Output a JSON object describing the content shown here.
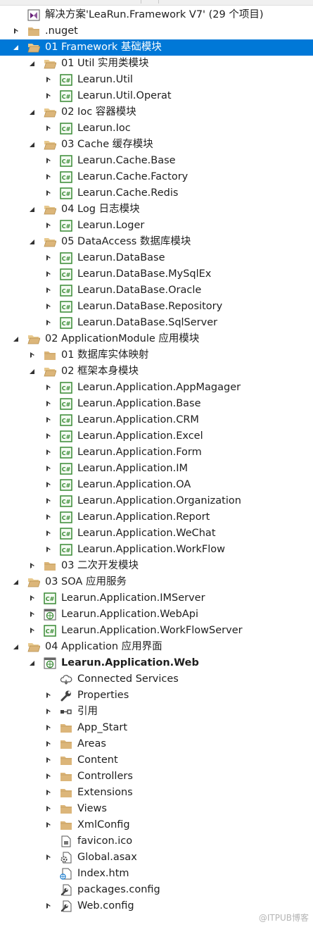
{
  "panel": "solution-explorer",
  "watermark": "@ITPUB博客",
  "colors": {
    "selection": "#0078d7",
    "folder": "#dcb67a",
    "project": "#388a34"
  },
  "tree": [
    {
      "label": "解决方案'LeaRun.Framework V7' (29 个项目)",
      "icon": "solution-icon",
      "level": 0,
      "toggle": "none"
    },
    {
      "label": ".nuget",
      "icon": "folder-icon",
      "level": 0,
      "toggle": "collapsed"
    },
    {
      "label": "01 Framework 基础模块",
      "icon": "folder-open-icon",
      "level": 0,
      "toggle": "expanded",
      "selected": true
    },
    {
      "label": "01 Util 实用类模块",
      "icon": "folder-open-icon",
      "level": 1,
      "toggle": "expanded"
    },
    {
      "label": "Learun.Util",
      "icon": "csharp-project-icon",
      "level": 2,
      "toggle": "collapsed"
    },
    {
      "label": "Learun.Util.Operat",
      "icon": "csharp-project-icon",
      "level": 2,
      "toggle": "collapsed"
    },
    {
      "label": "02 Ioc 容器模块",
      "icon": "folder-open-icon",
      "level": 1,
      "toggle": "expanded"
    },
    {
      "label": "Learun.Ioc",
      "icon": "csharp-project-icon",
      "level": 2,
      "toggle": "collapsed"
    },
    {
      "label": "03 Cache 缓存模块",
      "icon": "folder-open-icon",
      "level": 1,
      "toggle": "expanded"
    },
    {
      "label": "Learun.Cache.Base",
      "icon": "csharp-project-icon",
      "level": 2,
      "toggle": "collapsed"
    },
    {
      "label": "Learun.Cache.Factory",
      "icon": "csharp-project-icon",
      "level": 2,
      "toggle": "collapsed"
    },
    {
      "label": "Learun.Cache.Redis",
      "icon": "csharp-project-icon",
      "level": 2,
      "toggle": "collapsed"
    },
    {
      "label": "04 Log 日志模块",
      "icon": "folder-open-icon",
      "level": 1,
      "toggle": "expanded"
    },
    {
      "label": "Learun.Loger",
      "icon": "csharp-project-icon",
      "level": 2,
      "toggle": "collapsed"
    },
    {
      "label": "05 DataAccess 数据库模块",
      "icon": "folder-open-icon",
      "level": 1,
      "toggle": "expanded"
    },
    {
      "label": "Learun.DataBase",
      "icon": "csharp-project-icon",
      "level": 2,
      "toggle": "collapsed"
    },
    {
      "label": "Learun.DataBase.MySqlEx",
      "icon": "csharp-project-icon",
      "level": 2,
      "toggle": "collapsed"
    },
    {
      "label": "Learun.DataBase.Oracle",
      "icon": "csharp-project-icon",
      "level": 2,
      "toggle": "collapsed"
    },
    {
      "label": "Learun.DataBase.Repository",
      "icon": "csharp-project-icon",
      "level": 2,
      "toggle": "collapsed"
    },
    {
      "label": "Learun.DataBase.SqlServer",
      "icon": "csharp-project-icon",
      "level": 2,
      "toggle": "collapsed"
    },
    {
      "label": "02 ApplicationModule 应用模块",
      "icon": "folder-open-icon",
      "level": 0,
      "toggle": "expanded"
    },
    {
      "label": "01 数据库实体映射",
      "icon": "folder-icon",
      "level": 1,
      "toggle": "collapsed"
    },
    {
      "label": "02 框架本身模块",
      "icon": "folder-open-icon",
      "level": 1,
      "toggle": "expanded"
    },
    {
      "label": "Learun.Application.AppMagager",
      "icon": "csharp-project-icon",
      "level": 2,
      "toggle": "collapsed"
    },
    {
      "label": "Learun.Application.Base",
      "icon": "csharp-project-icon",
      "level": 2,
      "toggle": "collapsed"
    },
    {
      "label": "Learun.Application.CRM",
      "icon": "csharp-project-icon",
      "level": 2,
      "toggle": "collapsed"
    },
    {
      "label": "Learun.Application.Excel",
      "icon": "csharp-project-icon",
      "level": 2,
      "toggle": "collapsed"
    },
    {
      "label": "Learun.Application.Form",
      "icon": "csharp-project-icon",
      "level": 2,
      "toggle": "collapsed"
    },
    {
      "label": "Learun.Application.IM",
      "icon": "csharp-project-icon",
      "level": 2,
      "toggle": "collapsed"
    },
    {
      "label": "Learun.Application.OA",
      "icon": "csharp-project-icon",
      "level": 2,
      "toggle": "collapsed"
    },
    {
      "label": "Learun.Application.Organization",
      "icon": "csharp-project-icon",
      "level": 2,
      "toggle": "collapsed"
    },
    {
      "label": "Learun.Application.Report",
      "icon": "csharp-project-icon",
      "level": 2,
      "toggle": "collapsed"
    },
    {
      "label": "Learun.Application.WeChat",
      "icon": "csharp-project-icon",
      "level": 2,
      "toggle": "collapsed"
    },
    {
      "label": "Learun.Application.WorkFlow",
      "icon": "csharp-project-icon",
      "level": 2,
      "toggle": "collapsed"
    },
    {
      "label": "03 二次开发模块",
      "icon": "folder-icon",
      "level": 1,
      "toggle": "collapsed"
    },
    {
      "label": "03 SOA 应用服务",
      "icon": "folder-open-icon",
      "level": 0,
      "toggle": "expanded"
    },
    {
      "label": "Learun.Application.IMServer",
      "icon": "csharp-project-icon",
      "level": 1,
      "toggle": "collapsed"
    },
    {
      "label": "Learun.Application.WebApi",
      "icon": "web-project-icon",
      "level": 1,
      "toggle": "collapsed"
    },
    {
      "label": "Learun.Application.WorkFlowServer",
      "icon": "csharp-project-icon",
      "level": 1,
      "toggle": "collapsed"
    },
    {
      "label": "04 Application 应用界面",
      "icon": "folder-open-icon",
      "level": 0,
      "toggle": "expanded"
    },
    {
      "label": "Learun.Application.Web",
      "icon": "web-project-icon",
      "level": 1,
      "toggle": "expanded",
      "bold": true
    },
    {
      "label": "Connected Services",
      "icon": "connected-services-icon",
      "level": 2,
      "toggle": "none"
    },
    {
      "label": "Properties",
      "icon": "wrench-icon",
      "level": 2,
      "toggle": "collapsed"
    },
    {
      "label": "引用",
      "icon": "references-icon",
      "level": 2,
      "toggle": "collapsed"
    },
    {
      "label": "App_Start",
      "icon": "folder-icon",
      "level": 2,
      "toggle": "collapsed"
    },
    {
      "label": "Areas",
      "icon": "folder-icon",
      "level": 2,
      "toggle": "collapsed"
    },
    {
      "label": "Content",
      "icon": "folder-icon",
      "level": 2,
      "toggle": "collapsed"
    },
    {
      "label": "Controllers",
      "icon": "folder-icon",
      "level": 2,
      "toggle": "collapsed"
    },
    {
      "label": "Extensions",
      "icon": "folder-icon",
      "level": 2,
      "toggle": "collapsed"
    },
    {
      "label": "Views",
      "icon": "folder-icon",
      "level": 2,
      "toggle": "collapsed"
    },
    {
      "label": "XmlConfig",
      "icon": "folder-icon",
      "level": 2,
      "toggle": "collapsed"
    },
    {
      "label": "favicon.ico",
      "icon": "image-file-icon",
      "level": 2,
      "toggle": "none"
    },
    {
      "label": "Global.asax",
      "icon": "gear-file-icon",
      "level": 2,
      "toggle": "collapsed"
    },
    {
      "label": "Index.htm",
      "icon": "html-file-icon",
      "level": 2,
      "toggle": "none"
    },
    {
      "label": "packages.config",
      "icon": "config-file-icon",
      "level": 2,
      "toggle": "none"
    },
    {
      "label": "Web.config",
      "icon": "config-file-icon",
      "level": 2,
      "toggle": "collapsed"
    }
  ]
}
